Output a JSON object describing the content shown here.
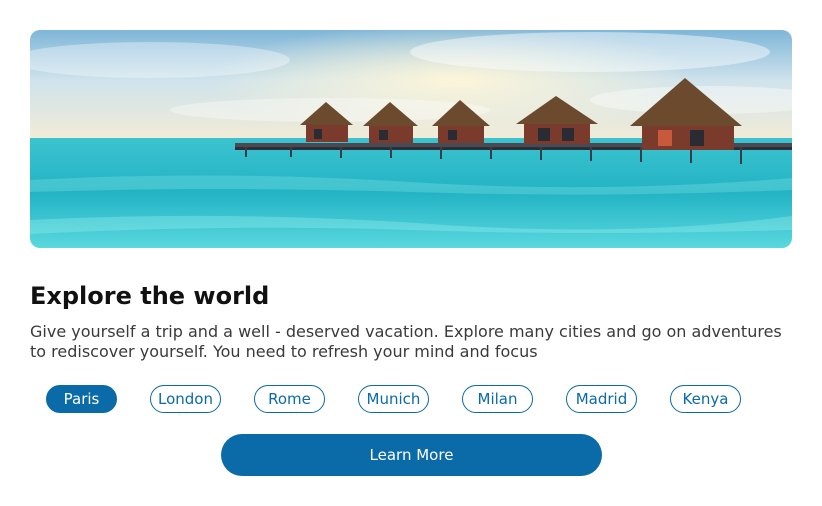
{
  "hero": {
    "image_name": "maldives-overwater-bungalows-image"
  },
  "content": {
    "title": "Explore the world",
    "description": "Give yourself a trip and a well - deserved vacation. Explore many cities and go on adventures to rediscover yourself. You need to refresh your mind and focus"
  },
  "cities": [
    {
      "label": "Paris",
      "active": true
    },
    {
      "label": "London",
      "active": false
    },
    {
      "label": "Rome",
      "active": false
    },
    {
      "label": "Munich",
      "active": false
    },
    {
      "label": "Milan",
      "active": false
    },
    {
      "label": "Madrid",
      "active": false
    },
    {
      "label": "Kenya",
      "active": false
    }
  ],
  "cta": {
    "label": "Learn More"
  },
  "colors": {
    "accent": "#0b6aa8",
    "title": "#111111",
    "text": "#3a3a3a"
  }
}
